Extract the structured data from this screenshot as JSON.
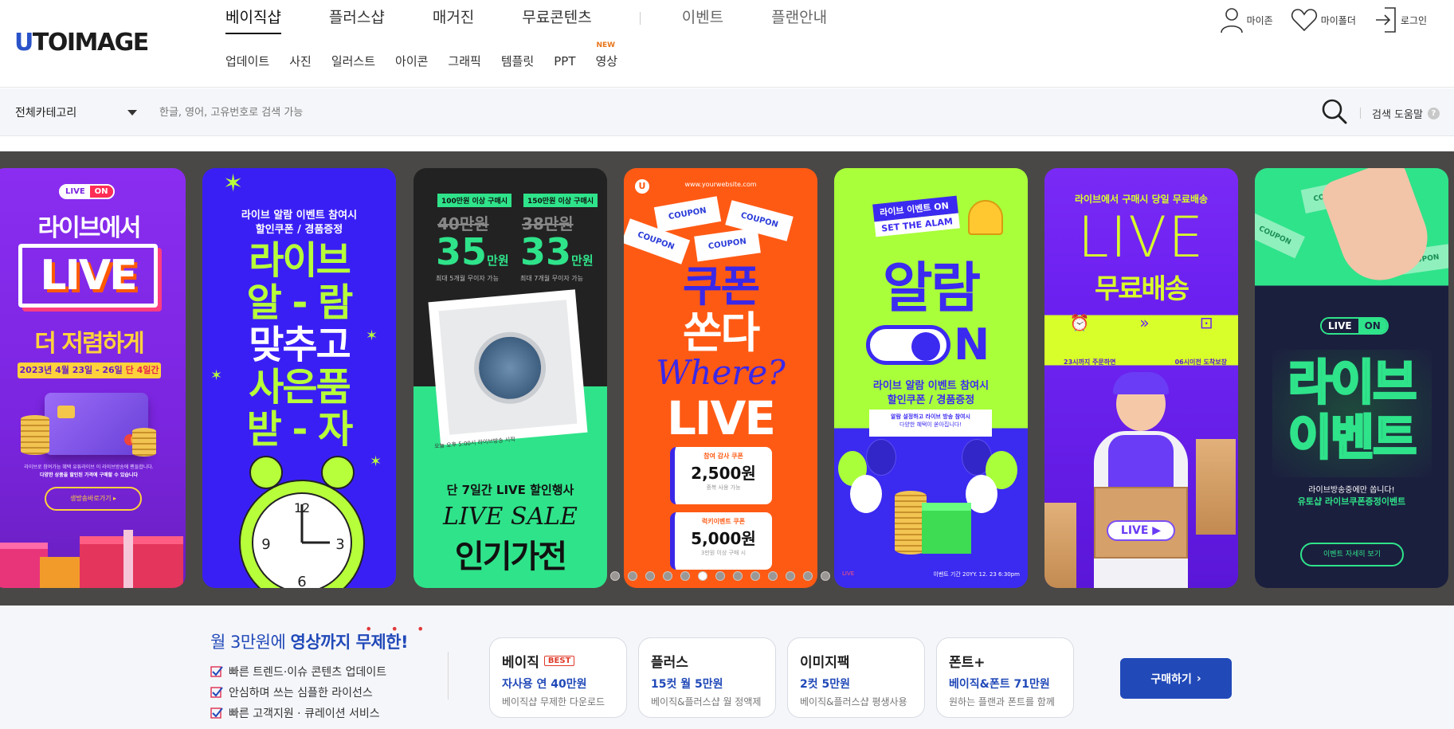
{
  "logo": {
    "prefix": "U",
    "text": "TOIMAGE"
  },
  "nav_main": [
    "베이직샵",
    "플러스샵",
    "매거진",
    "무료콘텐츠",
    "이벤트",
    "플랜안내"
  ],
  "nav_sub": [
    "업데이트",
    "사진",
    "일러스트",
    "아이콘",
    "그래픽",
    "템플릿",
    "PPT",
    "영상"
  ],
  "nav_sub_new_badge": "NEW",
  "util": {
    "myzone": "마이존",
    "myfolder": "마이폴더",
    "login": "로그인"
  },
  "search": {
    "category": "전체카테고리",
    "placeholder": "한글, 영어, 고유번호로 검색 가능",
    "help": "검색 도움말",
    "help_icon": "?"
  },
  "colors": {
    "brand_blue": "#2149b8",
    "carousel_bg": "#4a4846",
    "new_orange": "#e8741a"
  },
  "cards": {
    "c1": {
      "badge_live": "LIVE",
      "badge_on": "ON",
      "l1": "라이브에서",
      "big": "LIVE",
      "l2": "더 저렴하게",
      "date": "2023년 4월 23일 - 26일",
      "date_em": "단 4일간",
      "small": "라이브로 참여가능 혜택 유튜라이브 이 라이브방송에 팬들합니다.",
      "small2": "다양한 상품을 할인된 가격에 구매할 수 있습니다",
      "btn": "생방송바로가기 ▸"
    },
    "c2": {
      "top": "라이브 알람 이벤트 참여시",
      "top2": "할인쿠폰 / 경품증정",
      "lines": [
        "라이브",
        "알 - 람",
        "맞추고",
        "사은품",
        "받 - 자"
      ]
    },
    "c3": {
      "tag1": "100만원 이상 구매시",
      "tag2": "150만원 이상 구매시",
      "old1": "40만원",
      "old2": "38만원",
      "new1": "35",
      "new2": "33",
      "unit": "만원",
      "sub1": "최대 5개월 무이자 가능",
      "sub2": "최대 7개월 무이자 가능",
      "caption": "단 7일간 LIVE 할인행사",
      "script": "LIVE SALE",
      "big": "인기가전",
      "note": "오늘 오후 5:00시 라이브방송 시작"
    },
    "c4": {
      "url": "www.yourwebsite.com",
      "coupon": "COUPON",
      "l1": "쿠폰",
      "l2": "쏜다",
      "script": "Where?",
      "big": "LIVE",
      "t1": "참여 감사 쿠폰",
      "v1": "2,500원",
      "s1": "중복 사용 가능",
      "t2": "럭키이벤트 쿠폰",
      "v2": "5,000원",
      "s2": "3만원 이상 구매 시"
    },
    "c5": {
      "tag": "라이브 이벤트 ON",
      "tag2": "SET THE ALAM",
      "big": "알람",
      "on": "N",
      "l1": "라이브 알람 이벤트 참여시",
      "l2": "할인쿠폰 / 경품증정",
      "box": "알람 설정하고 라이브 방송 참여시",
      "box2": "다양한 혜택이 쏟아집니다!",
      "foot": "이벤트 기간 20YY. 12. 23 6:30pm",
      "live": "LIVE"
    },
    "c6": {
      "top": "라이브에서 구매시 당일 무료배송",
      "big": "LIVE",
      "l2": "무료배송",
      "i1": "23시까지 주문하면",
      "i2": "06시이전 도착보장",
      "live": "LIVE"
    },
    "c7": {
      "coupon": "COUPON",
      "badge_live": "LIVE",
      "badge_on": "ON",
      "l1": "라이브",
      "l2": "이벤트",
      "s1": "라이브방송중에만 쏩니다!",
      "s2": "유토샵 라이브쿠폰증정이벤트",
      "btn": "이벤트 자세히 보기"
    }
  },
  "carousel_dots": {
    "count": 13,
    "active": 5
  },
  "promo": {
    "h1": "월 3만원에 ",
    "h2": "영상까지 ",
    "h3": "무제한!",
    "checks": [
      "빠른 트렌드·이슈 콘텐츠 업데이트",
      "안심하며 쓰는 심플한 라이선스",
      "빠른 고객지원 · 큐레이션 서비스"
    ],
    "plans": [
      {
        "name": "베이직",
        "badge": "BEST",
        "price": "자사용 연 40만원",
        "desc": "베이직샵 무제한 다운로드"
      },
      {
        "name": "플러스",
        "badge": "",
        "price": "15컷 월 5만원",
        "desc": "베이직&플러스샵 월 정액제"
      },
      {
        "name": "이미지팩",
        "badge": "",
        "price": "2컷 5만원",
        "desc": "베이직&플러스샵 평생사용"
      },
      {
        "name": "폰트+",
        "badge": "",
        "price": "베이직&폰트 71만원",
        "desc": "원하는 플랜과 폰트를 함께"
      }
    ],
    "buy": "구매하기"
  }
}
